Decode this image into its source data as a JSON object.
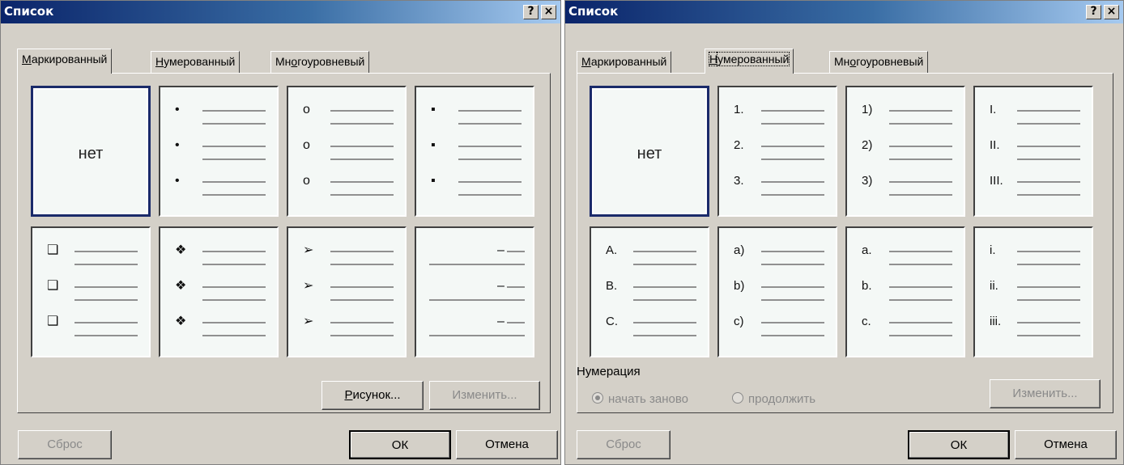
{
  "left": {
    "title": "Список",
    "help_label": "?",
    "close_label": "×",
    "tabs": [
      {
        "label": "Маркированный",
        "underline": "М",
        "rest": "аркированный"
      },
      {
        "label": "Нумерованный",
        "underline": "Н",
        "rest": "умерованный"
      },
      {
        "pre": "Мн",
        "underline": "о",
        "rest": "гоуровневый",
        "label": "Многоуровневый"
      }
    ],
    "none_label": "нет",
    "bullet_styles": [
      "•",
      "o",
      "▪",
      "❑",
      "❖",
      "➢",
      "–"
    ],
    "picture_button": {
      "underline": "Р",
      "rest": "исунок...",
      "label": "Рисунок..."
    },
    "change_button": "Изменить...",
    "reset_button": "Сброс",
    "ok_button": "ОК",
    "cancel_button": "Отмена"
  },
  "right": {
    "title": "Список",
    "help_label": "?",
    "close_label": "×",
    "tabs": [
      {
        "label": "Маркированный",
        "underline": "М",
        "rest": "аркированный"
      },
      {
        "label": "Нумерованный",
        "underline": "Н",
        "rest": "умерованный"
      },
      {
        "pre": "Мн",
        "underline": "о",
        "rest": "гоуровневый",
        "label": "Многоуровневый"
      }
    ],
    "none_label": "нет",
    "number_styles": [
      [
        "1.",
        "2.",
        "3."
      ],
      [
        "1)",
        "2)",
        "3)"
      ],
      [
        "I.",
        "II.",
        "III."
      ],
      [
        "A.",
        "B.",
        "C."
      ],
      [
        "a)",
        "b)",
        "c)"
      ],
      [
        "a.",
        "b.",
        "c."
      ],
      [
        "i.",
        "ii.",
        "iii."
      ]
    ],
    "numbering_group": "Нумерация",
    "restart_radio": "начать заново",
    "continue_radio": "продолжить",
    "change_button": "Изменить...",
    "reset_button": "Сброс",
    "ok_button": "ОК",
    "cancel_button": "Отмена"
  }
}
